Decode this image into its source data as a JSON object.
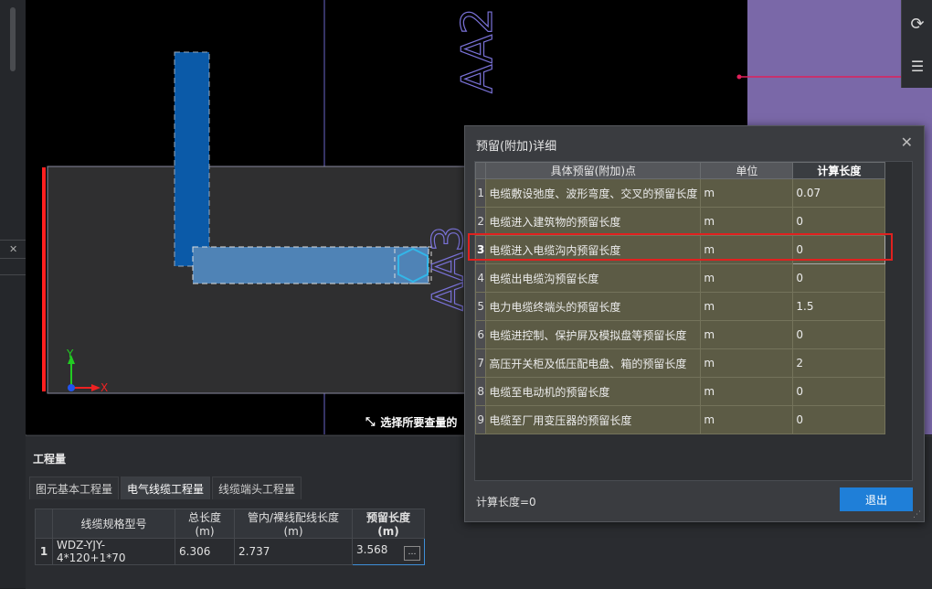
{
  "canvas": {
    "label_top": "AA2",
    "axis_y": "Y",
    "axis_x": "X"
  },
  "hint": {
    "text": "选择所要查量的"
  },
  "bottom": {
    "title": "工程量",
    "tabs": [
      "图元基本工程量",
      "电气线缆工程量",
      "线缆端头工程量"
    ],
    "active_tab": 1,
    "columns": [
      "线缆规格型号",
      "总长度(m)",
      "管内/裸线配线长度(m)",
      "预留长度(m)"
    ],
    "rows": [
      {
        "num": "1",
        "model": "WDZ-YJY-4*120+1*70",
        "total": "6.306",
        "pipe": "2.737",
        "reserve": "3.568"
      }
    ],
    "ellipsis": "…"
  },
  "dialog": {
    "title": "预留(附加)详细",
    "close": "✕",
    "columns": [
      "具体预留(附加)点",
      "单位",
      "计算长度"
    ],
    "rows": [
      {
        "num": "1",
        "point": "电缆敷设弛度、波形弯度、交叉的预留长度",
        "unit": "m",
        "value": "0.07"
      },
      {
        "num": "2",
        "point": "电缆进入建筑物的预留长度",
        "unit": "m",
        "value": "0"
      },
      {
        "num": "3",
        "point": "电缆进入电缆沟内预留长度",
        "unit": "m",
        "value": "0"
      },
      {
        "num": "4",
        "point": "电缆出电缆沟预留长度",
        "unit": "m",
        "value": "0"
      },
      {
        "num": "5",
        "point": "电力电缆终端头的预留长度",
        "unit": "m",
        "value": "1.5"
      },
      {
        "num": "6",
        "point": "电缆进控制、保护屏及模拟盘等预留长度",
        "unit": "m",
        "value": "0"
      },
      {
        "num": "7",
        "point": "高压开关柜及低压配电盘、箱的预留长度",
        "unit": "m",
        "value": "2"
      },
      {
        "num": "8",
        "point": "电缆至电动机的预留长度",
        "unit": "m",
        "value": "0"
      },
      {
        "num": "9",
        "point": "电缆至厂用变压器的预留长度",
        "unit": "m",
        "value": "0"
      }
    ],
    "formula": "计算长度=0",
    "exit_label": "退出"
  },
  "colors": {
    "accent": "#1f7fd8",
    "highlight": "#e0211f",
    "row_bg": "#5c5b45",
    "purple_region": "#7a68a8"
  }
}
